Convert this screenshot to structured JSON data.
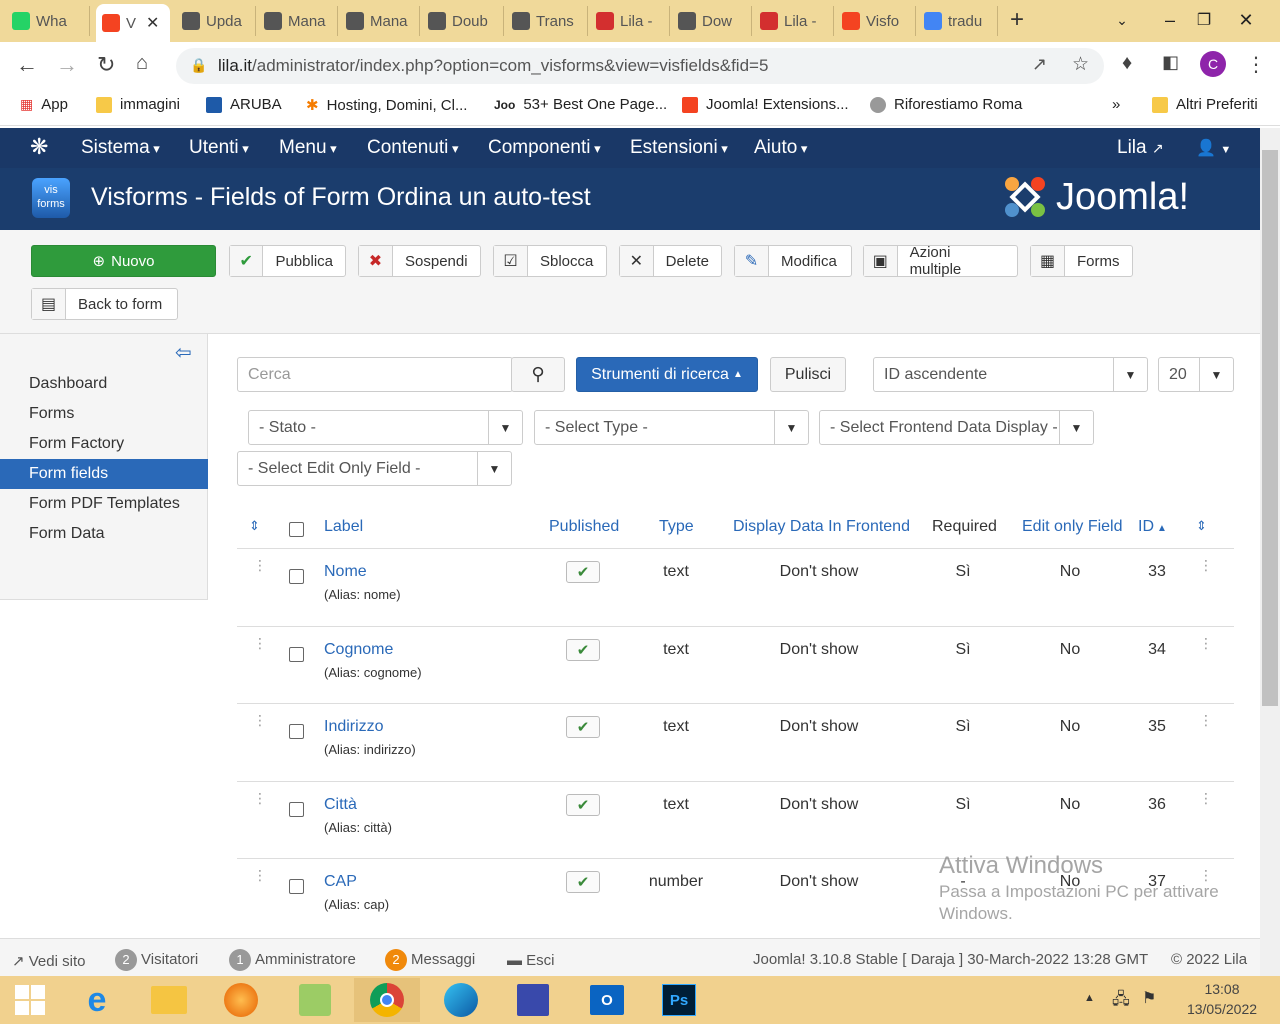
{
  "browser": {
    "tabs": [
      {
        "label": "Wha",
        "icon": "whatsapp-icon",
        "color": "#25d366"
      },
      {
        "label": "V",
        "icon": "joomla-icon",
        "color": "#f44321",
        "active": true
      },
      {
        "label": "Upda",
        "icon": "image-icon",
        "color": "#555"
      },
      {
        "label": "Mana",
        "icon": "image-icon",
        "color": "#555"
      },
      {
        "label": "Mana",
        "icon": "image-icon",
        "color": "#555"
      },
      {
        "label": "Doub",
        "icon": "image-icon",
        "color": "#555"
      },
      {
        "label": "Trans",
        "icon": "image-icon",
        "color": "#555"
      },
      {
        "label": "Lila -",
        "icon": "lila-icon",
        "color": "#d32f2f"
      },
      {
        "label": "Dow",
        "icon": "image-icon",
        "color": "#555"
      },
      {
        "label": "Lila -",
        "icon": "lila-icon",
        "color": "#d32f2f"
      },
      {
        "label": "Visfo",
        "icon": "joomla-icon",
        "color": "#f44321"
      },
      {
        "label": "tradu",
        "icon": "google-icon",
        "color": "#4285f4"
      }
    ],
    "url_host": "lila.it",
    "url_path": "/administrator/index.php?option=com_visforms&view=visfields&fid=5",
    "profile_initial": "C",
    "bookmarks": [
      "App",
      "immagini",
      "ARUBA",
      "Hosting, Domini, Cl...",
      "53+ Best One Page...",
      "Joomla! Extensions...",
      "Riforestiamo Roma"
    ],
    "bookmarks_more": "»",
    "other_bookmarks": "Altri Preferiti"
  },
  "joomla": {
    "menu": [
      "Sistema",
      "Utenti",
      "Menu",
      "Contenuti",
      "Componenti",
      "Estensioni",
      "Aiuto"
    ],
    "user_site": "Lila",
    "page_title": "Visforms - Fields of Form Ordina un auto-test",
    "logo_text": "Joomla!",
    "component_logo_top": "vis",
    "component_logo_bottom": "forms",
    "toolbar": {
      "new": "Nuovo",
      "publish": "Pubblica",
      "unpublish": "Sospendi",
      "unlock": "Sblocca",
      "delete": "Delete",
      "edit": "Modifica",
      "batch": "Azioni multiple",
      "forms": "Forms",
      "back": "Back to form"
    },
    "sidebar": [
      "Dashboard",
      "Forms",
      "Form Factory",
      "Form fields",
      "Form PDF Templates",
      "Form Data"
    ],
    "search": {
      "placeholder": "Cerca",
      "tools": "Strumenti di ricerca",
      "clear": "Pulisci",
      "ordering": "ID ascendente",
      "limit": "20"
    },
    "filters": {
      "state": "- Stato -",
      "type": "- Select Type -",
      "frontend": "- Select Frontend Data Display -",
      "editonly": "- Select Edit Only Field -"
    },
    "columns": {
      "label": "Label",
      "published": "Published",
      "type": "Type",
      "display": "Display Data In Frontend",
      "required": "Required",
      "editonly": "Edit only Field",
      "id": "ID"
    },
    "rows": [
      {
        "label": "Nome",
        "alias": "(Alias: nome)",
        "type": "text",
        "display": "Don't show",
        "required": "Sì",
        "editonly": "No",
        "id": "33"
      },
      {
        "label": "Cognome",
        "alias": "(Alias: cognome)",
        "type": "text",
        "display": "Don't show",
        "required": "Sì",
        "editonly": "No",
        "id": "34"
      },
      {
        "label": "Indirizzo",
        "alias": "(Alias: indirizzo)",
        "type": "text",
        "display": "Don't show",
        "required": "Sì",
        "editonly": "No",
        "id": "35"
      },
      {
        "label": "Città",
        "alias": "(Alias: città)",
        "type": "text",
        "display": "Don't show",
        "required": "Sì",
        "editonly": "No",
        "id": "36"
      },
      {
        "label": "CAP",
        "alias": "(Alias: cap)",
        "type": "number",
        "display": "Don't show",
        "required": "-",
        "editonly": "No",
        "id": "37"
      }
    ],
    "status": {
      "view_site": "Vedi sito",
      "visitors_count": "2",
      "visitors": "Visitatori",
      "admins_count": "1",
      "admins": "Amministratore",
      "messages_count": "2",
      "messages": "Messaggi",
      "logout": "Esci",
      "version": "Joomla! 3.10.8 Stable [ Daraja ] 30-March-2022 13:28 GMT",
      "copyright": "© 2022 Lila"
    }
  },
  "watermark": {
    "line1": "Attiva Windows",
    "line2": "Passa a Impostazioni PC per attivare",
    "line3": "Windows."
  },
  "taskbar": {
    "time": "13:08",
    "date": "13/05/2022"
  },
  "colors": {
    "joomla_nav": "#1a3867",
    "joomla_header": "#1b3d6d",
    "primary": "#2a69b8",
    "success": "#2f9b3c",
    "taskbar": "#f1d18e"
  }
}
